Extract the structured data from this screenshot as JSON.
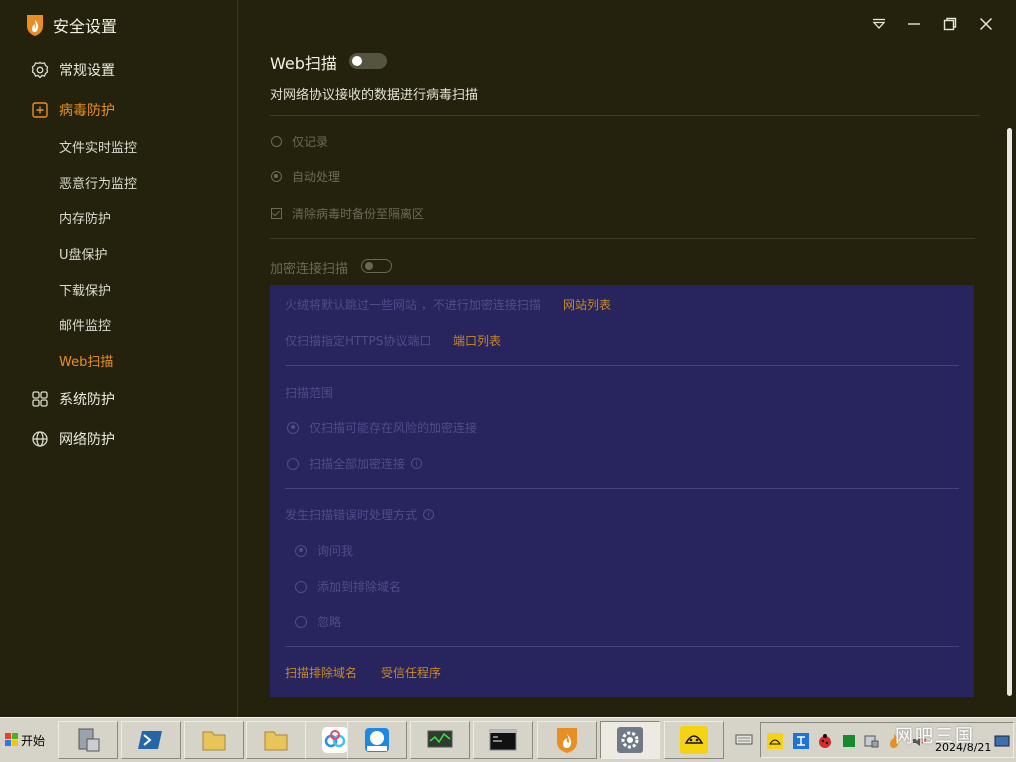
{
  "app": {
    "title": "安全设置",
    "logo": "huorong-flame-logo"
  },
  "colors": {
    "bg": "#24210c",
    "accent": "#e88f24",
    "panel": "#27245e",
    "link": "#c88a27"
  },
  "sidebar": {
    "items": [
      {
        "label": "常规设置",
        "icon": "gear-icon"
      },
      {
        "label": "病毒防护",
        "icon": "plus-square-icon",
        "active": true
      },
      {
        "label": "系统防护",
        "icon": "grid-icon"
      },
      {
        "label": "网络防护",
        "icon": "globe-icon"
      }
    ],
    "sub_items": [
      {
        "label": "文件实时监控"
      },
      {
        "label": "恶意行为监控"
      },
      {
        "label": "内存防护"
      },
      {
        "label": "U盘保护"
      },
      {
        "label": "下载保护"
      },
      {
        "label": "邮件监控"
      },
      {
        "label": "Web扫描",
        "active": true
      }
    ]
  },
  "window_controls": [
    "dropdown-icon",
    "minimize-icon",
    "restore-icon",
    "close-icon"
  ],
  "web_scan": {
    "title": "Web扫描",
    "enabled": false,
    "description": "对网络协议接收的数据进行病毒扫描",
    "options": [
      {
        "type": "radio",
        "label": "仅记录",
        "checked": false
      },
      {
        "type": "radio",
        "label": "自动处理",
        "checked": true
      },
      {
        "type": "checkbox",
        "label": "清除病毒时备份至隔离区",
        "checked": true
      }
    ]
  },
  "encrypted_scan": {
    "title": "加密连接扫描",
    "enabled": false,
    "skip_text": "火绒将默认跳过一些网站 ，不进行加密连接扫描",
    "site_list_link": "网站列表",
    "port_text": "仅扫描指定HTTPS协议端口",
    "port_list_link": "端口列表",
    "scope_title": "扫描范围",
    "scope_options": [
      {
        "label": "仅扫描可能存在风险的加密连接",
        "checked": true
      },
      {
        "label": "扫描全部加密连接",
        "checked": false,
        "info": true
      }
    ],
    "error_title": "发生扫描错误时处理方式",
    "error_options": [
      {
        "label": "询问我",
        "checked": true
      },
      {
        "label": "添加到排除域名",
        "checked": false
      },
      {
        "label": "忽略",
        "checked": false
      }
    ],
    "bottom_links": [
      "扫描排除域名",
      "受信任程序"
    ]
  },
  "taskbar": {
    "start_label": "开始",
    "buttons": [
      "server-manager-icon",
      "powershell-icon",
      "folder-icon",
      "folder-icon",
      "baidu-netdisk-icon",
      "assistant-icon",
      "task-monitor-icon",
      "cmd-icon",
      "huorong-icon",
      "settings-icon",
      "good-driver-icon"
    ],
    "clock": "2024/8/21",
    "watermark": "网吧三国"
  }
}
